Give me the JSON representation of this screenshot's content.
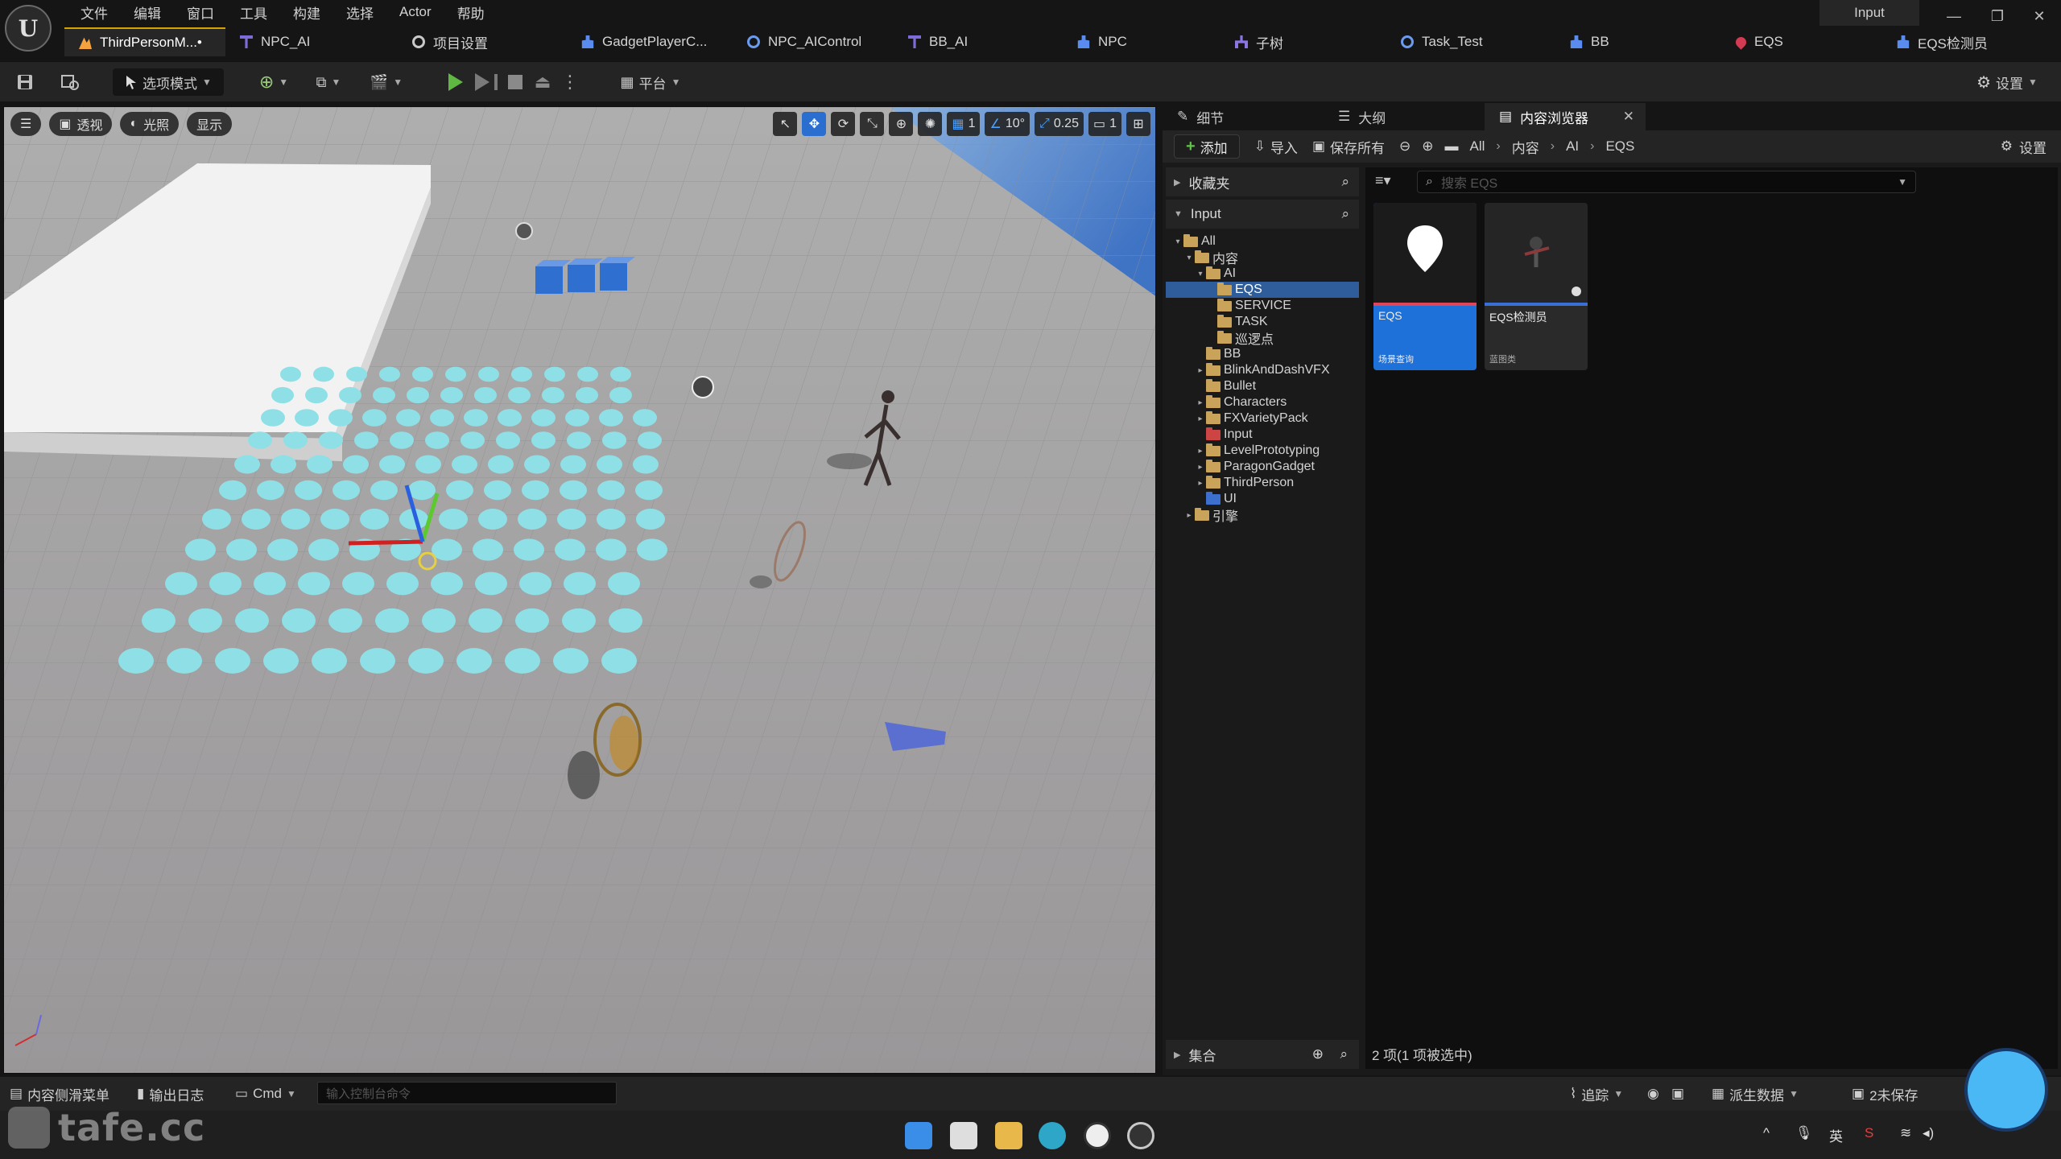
{
  "menu": [
    "文件",
    "编辑",
    "窗口",
    "工具",
    "构建",
    "选择",
    "Actor",
    "帮助"
  ],
  "tabs": [
    {
      "label": "ThirdPersonM...•",
      "icon": "level-icon",
      "active": true
    },
    {
      "label": "NPC_AI",
      "icon": "blueprint-icon"
    },
    {
      "label": "项目设置",
      "icon": "gear-icon"
    },
    {
      "label": "GadgetPlayerC...",
      "icon": "person-icon"
    },
    {
      "label": "NPC_AIControl",
      "icon": "task-icon"
    },
    {
      "label": "BB_AI",
      "icon": "blueprint-icon"
    },
    {
      "label": "NPC",
      "icon": "person-icon"
    },
    {
      "label": "子树",
      "icon": "tree-icon"
    },
    {
      "label": "Task_Test",
      "icon": "task-icon"
    },
    {
      "label": "BB",
      "icon": "person-icon"
    },
    {
      "label": "EQS",
      "icon": "pin-icon"
    },
    {
      "label": "EQS检测员",
      "icon": "person-icon"
    }
  ],
  "title_input": "Input",
  "toolbar": {
    "mode_label": "选项模式",
    "platform_label": "平台",
    "settings_label": "设置"
  },
  "viewport": {
    "perspective": "透视",
    "lighting": "光照",
    "show": "显示",
    "grid_value": "1",
    "angle_value": "10°",
    "scale_value": "0.25",
    "camera_value": "1"
  },
  "right_panel": {
    "tabs": [
      "细节",
      "大纲",
      "内容浏览器"
    ],
    "add_label": "添加",
    "import_label": "导入",
    "save_all_label": "保存所有",
    "breadcrumb": [
      "All",
      "内容",
      "AI",
      "EQS"
    ],
    "settings_label": "设置",
    "favorites_label": "收藏夹",
    "input_label": "Input",
    "collections_label": "集合",
    "search_placeholder": "搜索 EQS",
    "status": "2 项(1 项被选中)"
  },
  "tree": [
    {
      "label": "All",
      "depth": 0,
      "arrow": "▾",
      "color": "normal"
    },
    {
      "label": "内容",
      "depth": 1,
      "arrow": "▾",
      "color": "normal"
    },
    {
      "label": "AI",
      "depth": 2,
      "arrow": "▾",
      "color": "normal"
    },
    {
      "label": "EQS",
      "depth": 3,
      "arrow": "",
      "color": "normal",
      "selected": true
    },
    {
      "label": "SERVICE",
      "depth": 3,
      "arrow": "",
      "color": "normal"
    },
    {
      "label": "TASK",
      "depth": 3,
      "arrow": "",
      "color": "normal"
    },
    {
      "label": "巡逻点",
      "depth": 3,
      "arrow": "",
      "color": "normal"
    },
    {
      "label": "BB",
      "depth": 2,
      "arrow": "",
      "color": "normal"
    },
    {
      "label": "BlinkAndDashVFX",
      "depth": 2,
      "arrow": "▸",
      "color": "normal"
    },
    {
      "label": "Bullet",
      "depth": 2,
      "arrow": "",
      "color": "normal"
    },
    {
      "label": "Characters",
      "depth": 2,
      "arrow": "▸",
      "color": "normal"
    },
    {
      "label": "FXVarietyPack",
      "depth": 2,
      "arrow": "▸",
      "color": "normal"
    },
    {
      "label": "Input",
      "depth": 2,
      "arrow": "",
      "color": "red"
    },
    {
      "label": "LevelPrototyping",
      "depth": 2,
      "arrow": "▸",
      "color": "normal"
    },
    {
      "label": "ParagonGadget",
      "depth": 2,
      "arrow": "▸",
      "color": "normal"
    },
    {
      "label": "ThirdPerson",
      "depth": 2,
      "arrow": "▸",
      "color": "normal"
    },
    {
      "label": "UI",
      "depth": 2,
      "arrow": "",
      "color": "blue"
    },
    {
      "label": "引擎",
      "depth": 1,
      "arrow": "▸",
      "color": "normal"
    }
  ],
  "assets": [
    {
      "name": "EQS",
      "type": "场景查询",
      "selected": true
    },
    {
      "name": "EQS检测员",
      "type": "蓝图类",
      "selected": false
    }
  ],
  "bottom": {
    "content_drawer": "内容侧滑菜单",
    "output_log": "输出日志",
    "cmd": "Cmd",
    "cmd_placeholder": "输入控制台命令",
    "trace": "追踪",
    "derived_data": "派生数据",
    "unsaved": "2未保存"
  },
  "watermark": "tafe.cc",
  "tray": {
    "ime": "英"
  }
}
